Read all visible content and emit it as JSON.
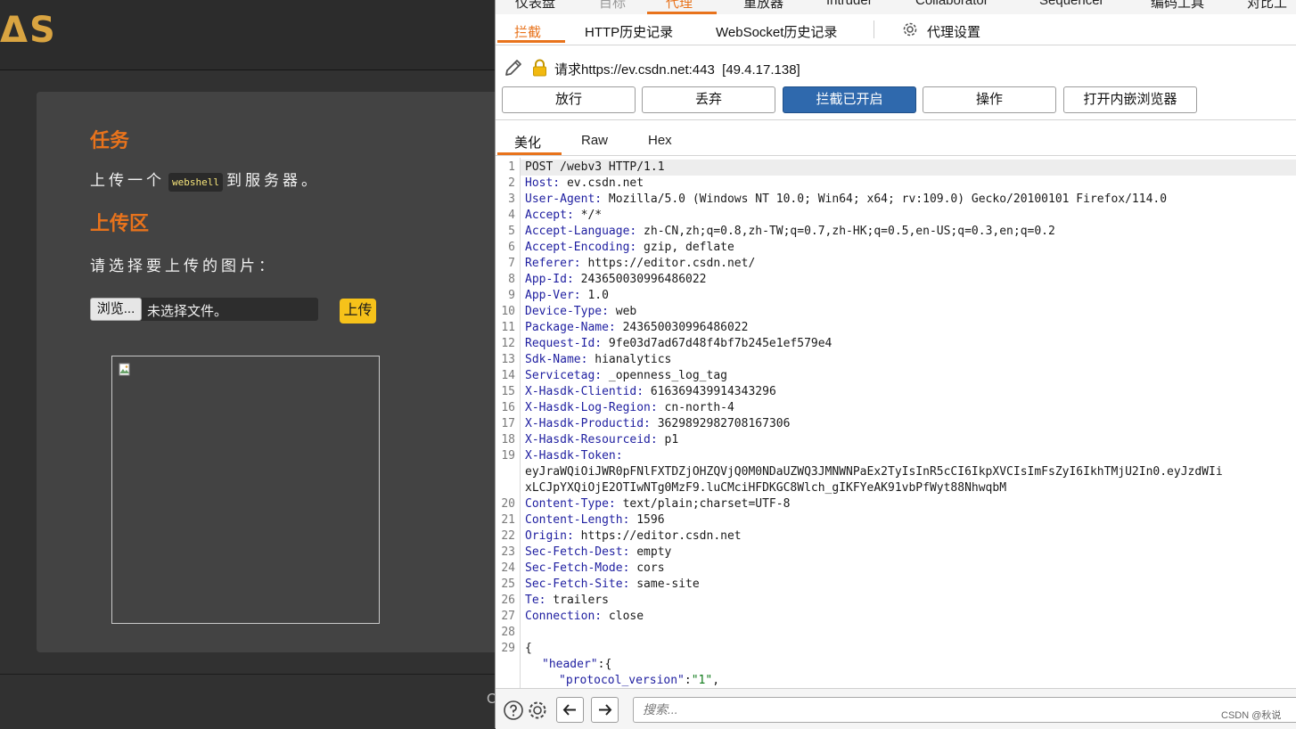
{
  "left_page": {
    "logo": "ᐃS",
    "task_title": "任务",
    "task_text_before": "上传一个",
    "task_code": "webshell",
    "task_text_after": "到服务器。",
    "upload_title": "上传区",
    "choose_text": "请选择要上传的图片：",
    "browse_label": "浏览...",
    "no_file_text": "未选择文件。",
    "upload_label": "上传",
    "footer_peek": "C"
  },
  "burp": {
    "top_tabs": [
      "仪表盘",
      "目标",
      "代理",
      "重放器",
      "Intruder",
      "Sequencer",
      "Collaborator",
      "编码工具",
      "对比工具"
    ],
    "sub_tabs": [
      "拦截",
      "HTTP历史记录",
      "WebSocket历史记录",
      "代理设置"
    ],
    "request_info": "请求https://ev.csdn.net:443  [49.4.17.138]",
    "buttons": {
      "forward": "放行",
      "drop": "丢弃",
      "intercept": "拦截已开启",
      "action": "操作",
      "open_browser": "打开内嵌浏览器"
    },
    "view_tabs": [
      "美化",
      "Raw",
      "Hex"
    ],
    "lines": [
      {
        "n": "1",
        "name": "",
        "value": "POST /webv3 HTTP/1.1"
      },
      {
        "n": "2",
        "name": "Host:",
        "value": " ev.csdn.net"
      },
      {
        "n": "3",
        "name": "User-Agent:",
        "value": " Mozilla/5.0 (Windows NT 10.0; Win64; x64; rv:109.0) Gecko/20100101 Firefox/114.0"
      },
      {
        "n": "4",
        "name": "Accept:",
        "value": " */*"
      },
      {
        "n": "5",
        "name": "Accept-Language:",
        "value": " zh-CN,zh;q=0.8,zh-TW;q=0.7,zh-HK;q=0.5,en-US;q=0.3,en;q=0.2"
      },
      {
        "n": "6",
        "name": "Accept-Encoding:",
        "value": " gzip, deflate"
      },
      {
        "n": "7",
        "name": "Referer:",
        "value": " https://editor.csdn.net/"
      },
      {
        "n": "8",
        "name": "App-Id:",
        "value": " 243650030996486022"
      },
      {
        "n": "9",
        "name": "App-Ver:",
        "value": " 1.0"
      },
      {
        "n": "10",
        "name": "Device-Type:",
        "value": " web"
      },
      {
        "n": "11",
        "name": "Package-Name:",
        "value": " 243650030996486022"
      },
      {
        "n": "12",
        "name": "Request-Id:",
        "value": " 9fe03d7ad67d48f4bf7b245e1ef579e4"
      },
      {
        "n": "13",
        "name": "Sdk-Name:",
        "value": " hianalytics"
      },
      {
        "n": "14",
        "name": "Servicetag:",
        "value": " _openness_log_tag"
      },
      {
        "n": "15",
        "name": "X-Hasdk-Clientid:",
        "value": " 616369439914343296"
      },
      {
        "n": "16",
        "name": "X-Hasdk-Log-Region:",
        "value": " cn-north-4"
      },
      {
        "n": "17",
        "name": "X-Hasdk-Productid:",
        "value": " 3629892982708167306"
      },
      {
        "n": "18",
        "name": "X-Hasdk-Resourceid:",
        "value": " p1"
      },
      {
        "n": "19",
        "name": "X-Hasdk-Token:",
        "value": ""
      },
      {
        "n": "",
        "name": "",
        "value": "eyJraWQiOiJWR0pFNlFXTDZjOHZQVjQ0M0NDaUZWQ3JMNWNPaEx2TyIsInR5cCI6IkpXVCIsImFsZyI6IkhTMjU2In0.eyJzdWIi"
      },
      {
        "n": "",
        "name": "",
        "value": "xLCJpYXQiOjE2OTIwNTg0MzF9.luCMciHFDKGC8Wlch_gIKFYeAK91vbPfWyt88NhwqbM"
      },
      {
        "n": "20",
        "name": "Content-Type:",
        "value": " text/plain;charset=UTF-8"
      },
      {
        "n": "21",
        "name": "Content-Length:",
        "value": " 1596"
      },
      {
        "n": "22",
        "name": "Origin:",
        "value": " https://editor.csdn.net"
      },
      {
        "n": "23",
        "name": "Sec-Fetch-Dest:",
        "value": " empty"
      },
      {
        "n": "24",
        "name": "Sec-Fetch-Mode:",
        "value": " cors"
      },
      {
        "n": "25",
        "name": "Sec-Fetch-Site:",
        "value": " same-site"
      },
      {
        "n": "26",
        "name": "Te:",
        "value": " trailers"
      },
      {
        "n": "27",
        "name": "Connection:",
        "value": " close"
      },
      {
        "n": "28",
        "name": "",
        "value": ""
      },
      {
        "n": "29",
        "name": "",
        "value": "{"
      }
    ],
    "json_lines": [
      {
        "key": "\"header\"",
        "rest": ":{"
      },
      {
        "key": "\"protocol_version\"",
        "colon": ":",
        "str": "\"1\"",
        "rest": ","
      }
    ],
    "search_placeholder": "搜索...",
    "watermark": "CSDN @秋说",
    "accent": "#e8731c",
    "primary_button": "#2f69ad"
  }
}
